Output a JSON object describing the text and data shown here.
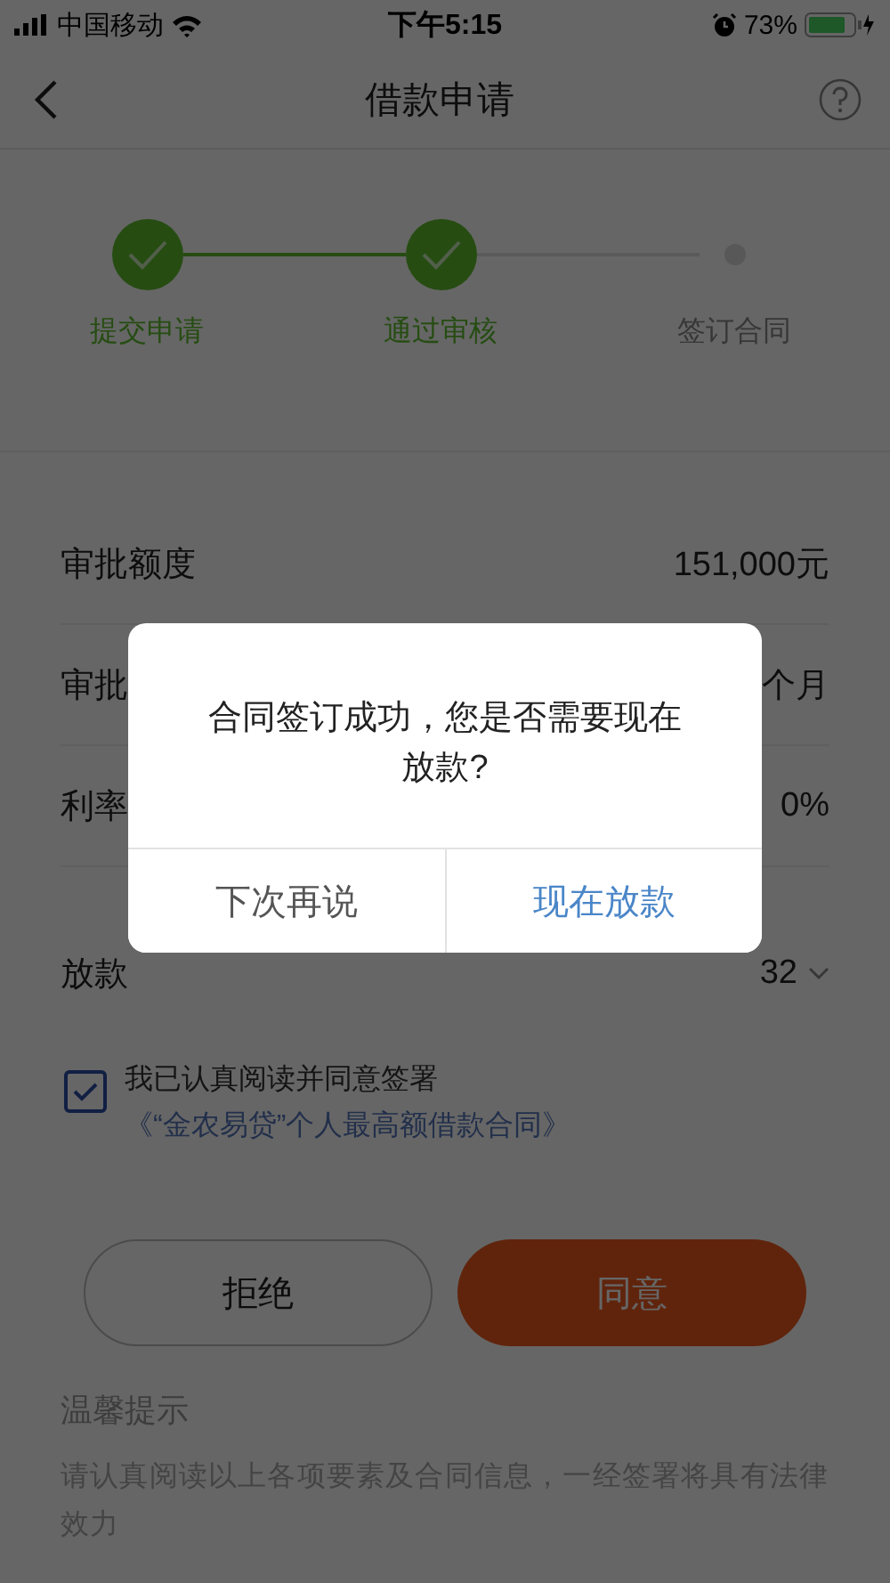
{
  "status_bar": {
    "carrier": "中国移动",
    "time": "下午5:15",
    "battery": "73%"
  },
  "nav": {
    "title": "借款申请"
  },
  "steps": [
    {
      "label": "提交申请",
      "done": true
    },
    {
      "label": "通过审核",
      "done": true
    },
    {
      "label": "签订合同",
      "done": false
    }
  ],
  "rows": [
    {
      "label": "审批额度",
      "value": "151,000元",
      "kind": "text"
    },
    {
      "label": "审批",
      "value": "个月",
      "kind": "text"
    },
    {
      "label": "利率",
      "value": "0%",
      "kind": "text"
    },
    {
      "label": "放款",
      "value": "32",
      "kind": "dropdown"
    }
  ],
  "agreement": {
    "checked": true,
    "text": "我已认真阅读并同意签署",
    "link": "《“金农易贷”个人最高额借款合同》"
  },
  "buttons": [
    {
      "label": "拒绝",
      "kind": "outline"
    },
    {
      "label": "同意",
      "kind": "primary"
    }
  ],
  "tips": {
    "title": "温馨提示",
    "text": "请认真阅读以上各项要素及合同信息，一经签署将具有法律效力"
  },
  "dialog": {
    "message": "合同签订成功，您是否需要现在放款?",
    "buttons": [
      {
        "label": "下次再说",
        "kind": "cancel"
      },
      {
        "label": "现在放款",
        "kind": "confirm"
      }
    ]
  }
}
